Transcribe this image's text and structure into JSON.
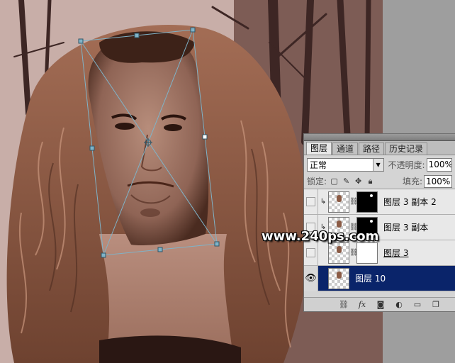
{
  "panel": {
    "tabs": [
      {
        "label": "图层"
      },
      {
        "label": "通道"
      },
      {
        "label": "路径"
      },
      {
        "label": "历史记录"
      }
    ],
    "blend_mode": "正常",
    "opacity_label": "不透明度:",
    "opacity_value": "100%",
    "lock_label": "锁定:",
    "fill_label": "填充:",
    "fill_value": "100%",
    "layers": [
      {
        "name": "图层 3 副本 2",
        "selected": false,
        "visible": false,
        "clipped": true,
        "mask": "black"
      },
      {
        "name": "图层 3 副本",
        "selected": false,
        "visible": false,
        "clipped": true,
        "mask": "black"
      },
      {
        "name": "图层 3",
        "selected": false,
        "visible": false,
        "clipped": false,
        "mask": "white"
      },
      {
        "name": "图层 10",
        "selected": true,
        "visible": true,
        "clipped": false,
        "mask": null
      }
    ]
  },
  "watermark": "www.240ps.com",
  "colors": {
    "selection": "#0a246a",
    "transform_box": "#7fb3c8",
    "panel_bg": "#d4d4d4"
  },
  "icons": {
    "bottom_bar": [
      "link-icon",
      "fx-icon",
      "add-mask-icon",
      "adjustment-icon",
      "new-group-icon",
      "new-layer-icon"
    ]
  }
}
